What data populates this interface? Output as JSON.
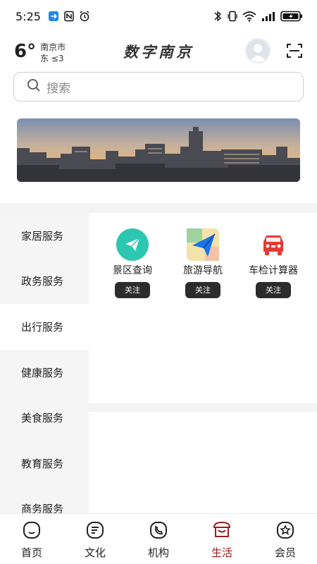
{
  "status_bar": {
    "time": "5:25",
    "icons": [
      "app-notification-icon",
      "nfc-icon",
      "alarm-icon",
      "vibrate-icon",
      "mute-icon",
      "wifi-icon",
      "signal-icon",
      "battery-charging-icon"
    ]
  },
  "header": {
    "temperature": "6°",
    "city": "南京市",
    "wind": "东 ≤3",
    "app_title": "数字南京"
  },
  "search": {
    "placeholder": "搜索"
  },
  "categories": [
    {
      "label": "家居服务",
      "active": false
    },
    {
      "label": "政务服务",
      "active": false
    },
    {
      "label": "出行服务",
      "active": true
    },
    {
      "label": "健康服务",
      "active": false
    },
    {
      "label": "美食服务",
      "active": false
    },
    {
      "label": "教育服务",
      "active": false
    },
    {
      "label": "商务服务",
      "active": false
    }
  ],
  "services": [
    {
      "label": "景区查询",
      "icon": "scenic-paper-plane-icon",
      "follow": "关注",
      "color": "#2cc7b0"
    },
    {
      "label": "旅游导航",
      "icon": "navigation-map-icon",
      "follow": "关注",
      "color": "#1a73e8"
    },
    {
      "label": "车检计算器",
      "icon": "car-inspection-icon",
      "follow": "关注",
      "color": "#e53935"
    }
  ],
  "tabs": [
    {
      "label": "首页",
      "icon": "home-icon",
      "active": false
    },
    {
      "label": "文化",
      "icon": "culture-icon",
      "active": false
    },
    {
      "label": "机构",
      "icon": "institution-icon",
      "active": false
    },
    {
      "label": "生活",
      "icon": "life-icon",
      "active": true
    },
    {
      "label": "会员",
      "icon": "member-icon",
      "active": false
    }
  ],
  "colors": {
    "accent": "#9b1c1c",
    "follow_button": "#2c2c2c"
  }
}
